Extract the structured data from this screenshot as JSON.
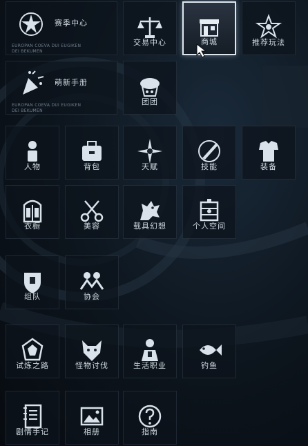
{
  "menu": {
    "row1": [
      {
        "label": "赛季中心",
        "sub": "EUROPAN COEVA DUI EUGIKEN\nDEI BEKUMEN",
        "icon": "season-star-icon"
      },
      {
        "label": "交易中心",
        "icon": "balance-scale-icon"
      },
      {
        "label": "商城",
        "icon": "shop-storefront-icon",
        "active": true
      },
      {
        "label": "推荐玩法",
        "icon": "recommend-star-icon"
      }
    ],
    "row2": [
      {
        "label": "萌新手册",
        "sub": "EUROPAN COEVA DUI EUGIKEN\nDEI BEKUMEN",
        "icon": "party-popper-icon"
      },
      {
        "label": "团团",
        "icon": "bubble-tea-icon"
      }
    ],
    "row3": [
      {
        "label": "人物",
        "icon": "character-icon"
      },
      {
        "label": "背包",
        "icon": "backpack-icon"
      },
      {
        "label": "天赋",
        "icon": "compass-star-icon"
      },
      {
        "label": "技能",
        "icon": "skill-blade-icon"
      },
      {
        "label": "装备",
        "icon": "armor-icon"
      }
    ],
    "row4": [
      {
        "label": "衣橱",
        "icon": "wardrobe-icon"
      },
      {
        "label": "美容",
        "icon": "scissors-icon"
      },
      {
        "label": "载具幻想",
        "icon": "mount-dragon-icon"
      },
      {
        "label": "个人空间",
        "icon": "personal-space-icon"
      }
    ],
    "row5": [
      {
        "label": "组队",
        "icon": "team-shield-icon"
      },
      {
        "label": "协会",
        "icon": "guild-people-icon"
      }
    ],
    "row6": [
      {
        "label": "试炼之路",
        "icon": "trial-emblem-icon"
      },
      {
        "label": "怪物讨伐",
        "icon": "monster-head-icon"
      },
      {
        "label": "生活职业",
        "icon": "life-job-icon"
      },
      {
        "label": "钓鱼",
        "icon": "fish-icon"
      }
    ],
    "row7": [
      {
        "label": "剧情手记",
        "icon": "notebook-icon"
      },
      {
        "label": "相册",
        "icon": "photo-album-icon"
      },
      {
        "label": "指南",
        "icon": "question-circle-icon"
      }
    ]
  }
}
